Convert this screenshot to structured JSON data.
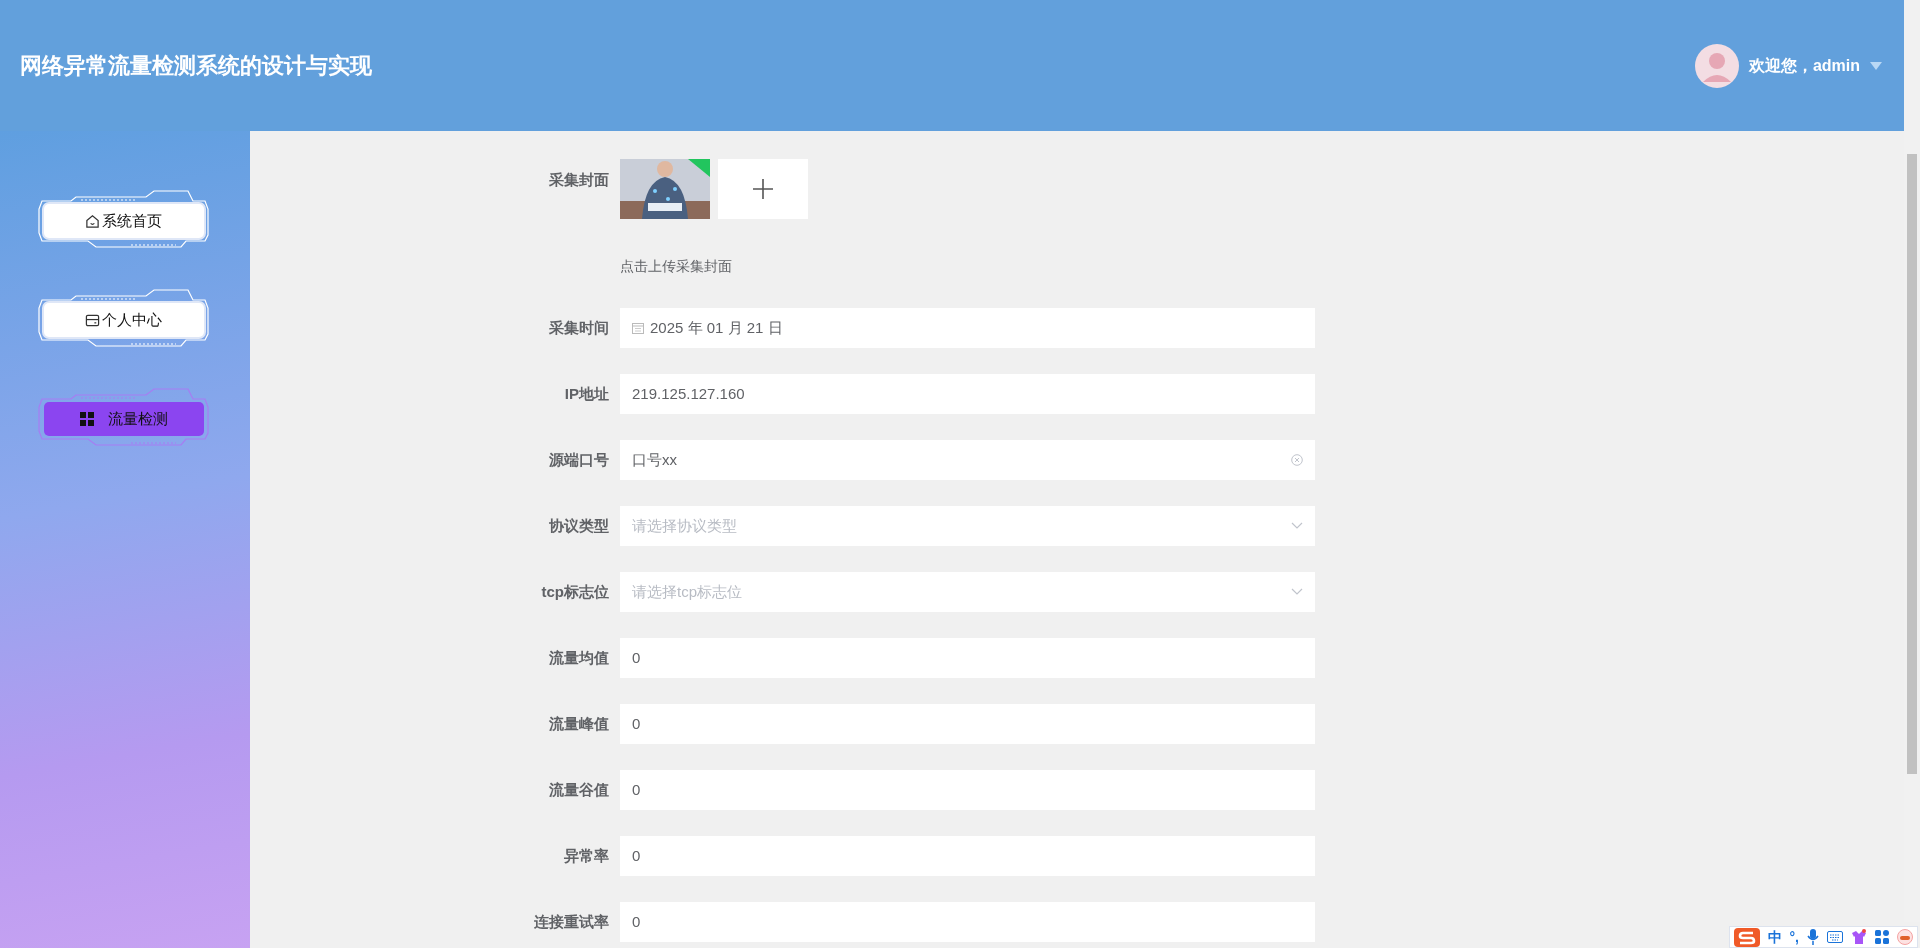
{
  "header": {
    "title": "网络异常流量检测系统的设计与实现",
    "welcome": "欢迎您，admin"
  },
  "sidebar": {
    "items": [
      {
        "kind": "home",
        "label": "系统首页",
        "selected": false
      },
      {
        "kind": "card",
        "label": "个人中心",
        "selected": false
      },
      {
        "kind": "grid",
        "label": "流量检测",
        "selected": true
      }
    ]
  },
  "form": {
    "cover": {
      "label": "采集封面",
      "hint": "点击上传采集封面"
    },
    "fields": [
      {
        "kind": "date",
        "label": "采集时间",
        "value": "2025 年 01 月 21 日"
      },
      {
        "kind": "text",
        "label": "IP地址",
        "value": "219.125.127.160"
      },
      {
        "kind": "clearable",
        "label": "源端口号",
        "value": "口号xx"
      },
      {
        "kind": "select",
        "label": "协议类型",
        "placeholder": "请选择协议类型"
      },
      {
        "kind": "select",
        "label": "tcp标志位",
        "placeholder": "请选择tcp标志位"
      },
      {
        "kind": "text",
        "label": "流量均值",
        "value": "0"
      },
      {
        "kind": "text",
        "label": "流量峰值",
        "value": "0"
      },
      {
        "kind": "text",
        "label": "流量谷值",
        "value": "0"
      },
      {
        "kind": "text",
        "label": "异常率",
        "value": "0"
      },
      {
        "kind": "text",
        "label": "连接重试率",
        "value": "0"
      }
    ]
  },
  "ime_bar": {
    "items": [
      "中",
      "°,"
    ]
  }
}
